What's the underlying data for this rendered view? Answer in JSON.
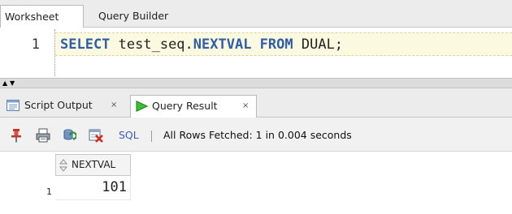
{
  "top_tabs": {
    "worksheet": "Worksheet",
    "query_builder": "Query Builder"
  },
  "editor": {
    "line_number": "1",
    "tokens": {
      "select": "SELECT",
      "seq_prefix": " test_seq.",
      "nextval": "NEXTVAL",
      "from": " FROM",
      "dual": " DUAL;"
    }
  },
  "splitter": {
    "up_arrow": "▲",
    "down_arrow": "▼"
  },
  "result_tabs": {
    "script_output": "Script Output",
    "query_result": "Query Result",
    "close_glyph": "×"
  },
  "toolbar": {
    "icons": [
      "pin-icon",
      "print-icon",
      "refresh-icon",
      "clear-icon"
    ],
    "sql_link": "SQL",
    "separator": "|",
    "status": "All Rows Fetched: 1 in 0.004 seconds"
  },
  "grid": {
    "columns": [
      "NEXTVAL"
    ],
    "rows": [
      {
        "row_number": "1",
        "values": [
          "101"
        ]
      }
    ]
  },
  "colors": {
    "keyword": "#2f5ea8",
    "current_line": "#fbf9df",
    "sql_link": "#3b5fc0"
  }
}
